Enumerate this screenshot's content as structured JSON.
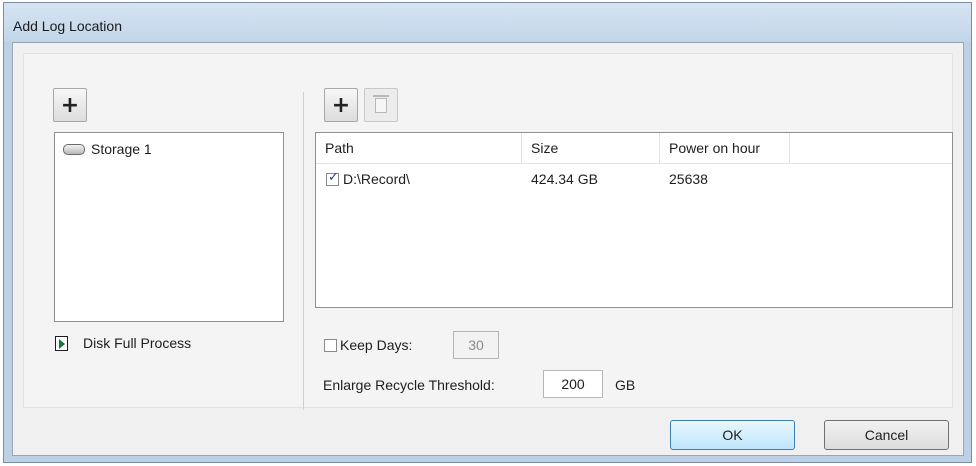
{
  "window": {
    "title": "Add Log Location"
  },
  "left_panel": {
    "add_symbol": "+",
    "storage_items": [
      {
        "label": "Storage 1"
      }
    ],
    "disk_full_label": "Disk Full Process"
  },
  "right_panel": {
    "add_symbol": "+",
    "delete_symbol": "🗑",
    "table": {
      "columns": [
        "Path",
        "Size",
        "Power on hour"
      ],
      "rows": [
        {
          "checked": true,
          "path": "D:\\Record\\",
          "size": "424.34 GB",
          "power_on_hour": "25638"
        }
      ]
    },
    "keep_days": {
      "label": "Keep Days:",
      "value": "30",
      "checked": false
    },
    "recycle": {
      "label": "Enlarge Recycle Threshold:",
      "value": "200",
      "unit": "GB"
    }
  },
  "buttons": {
    "ok": "OK",
    "cancel": "Cancel"
  },
  "colors": {
    "title_bar": "#c3d6ea",
    "client": "#f0f0f0",
    "ok_button": "#bee6fd",
    "check": "#1f3f86",
    "disk_full_icon": "#0f7a3a"
  }
}
